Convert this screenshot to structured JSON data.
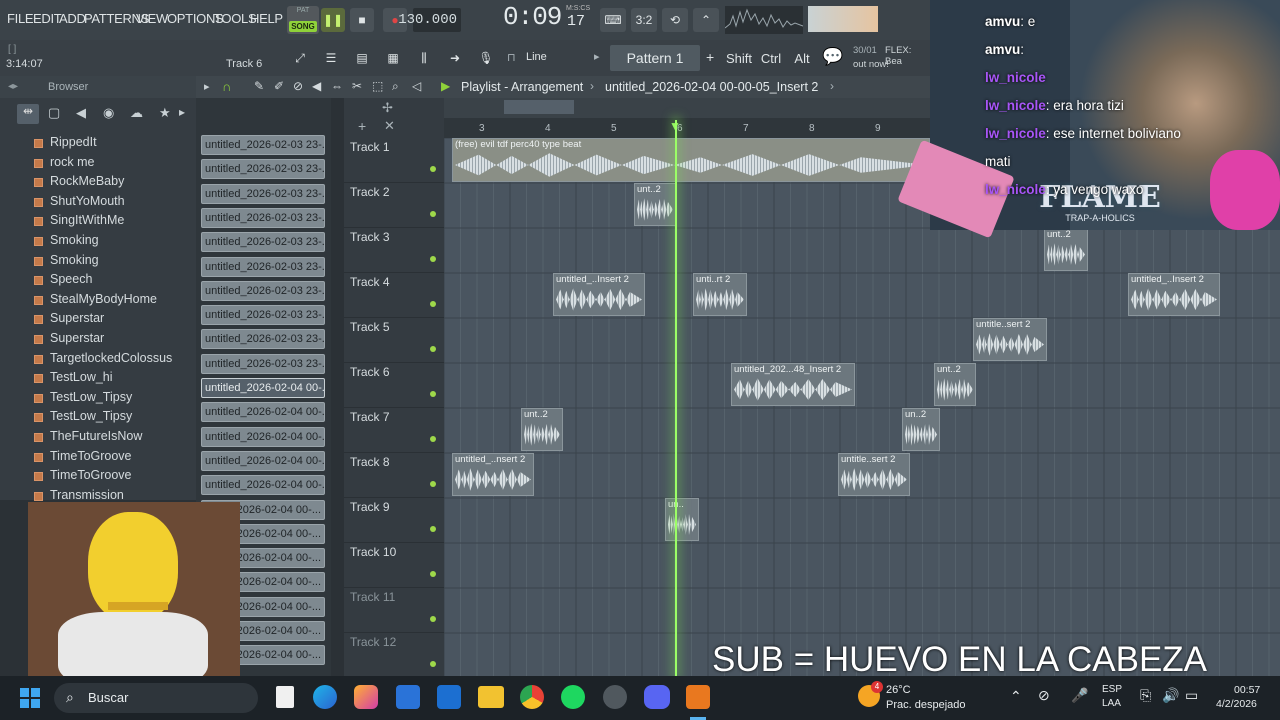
{
  "menu": {
    "items": [
      "FILE",
      "EDIT",
      "ADD",
      "PATTERNS",
      "VIEW",
      "OPTIONS",
      "TOOLS",
      "HELP"
    ]
  },
  "transport": {
    "pat_label": "PAT",
    "song_label": "SONG",
    "tempo": "130.000",
    "time": "0:09",
    "time_ms": "17",
    "time_unit": "M:S:CS",
    "time_sig": "3:2"
  },
  "toolbar2": {
    "hint": "Track 6",
    "position": "3:14:07",
    "line_mode": "Line",
    "pattern": "Pattern 1",
    "shift": "Shift",
    "ctrl": "Ctrl",
    "alt": "Alt",
    "news_date": "30/01",
    "news_text": "FLEX: Bea",
    "news_text2": "out now!"
  },
  "browser": {
    "title": "Browser",
    "items": [
      "RippedIt",
      "rock me",
      "RockMeBaby",
      "ShutYoMouth",
      "SingItWithMe",
      "Smoking",
      "Smoking",
      "Speech",
      "StealMyBodyHome",
      "Superstar",
      "Superstar",
      "TargetlockedColossus",
      "TestLow_hi",
      "TestLow_Tipsy",
      "TestLow_Tipsy",
      "TheFutureIsNow",
      "TimeToGroove",
      "TimeToGroove",
      "Transmission"
    ]
  },
  "picker": {
    "clips": [
      "untitled_2026-02-03 23-...",
      "untitled_2026-02-03 23-...",
      "untitled_2026-02-03 23-...",
      "untitled_2026-02-03 23-...",
      "untitled_2026-02-03 23-...",
      "untitled_2026-02-03 23-...",
      "untitled_2026-02-03 23-...",
      "untitled_2026-02-03 23-...",
      "untitled_2026-02-03 23-...",
      "untitled_2026-02-03 23-...",
      "untitled_2026-02-04 00-...",
      "untitled_2026-02-04 00-...",
      "untitled_2026-02-04 00-...",
      "untitled_2026-02-04 00-...",
      "untitled_2026-02-04 00-...",
      "2026-02-04 00-...",
      "2026-02-04 00-...",
      "2026-02-04 00-...",
      "2026-02-04 00-...",
      "2026-02-04 00-...",
      "2026-02-04 00-...",
      "2026-02-04 00-..."
    ]
  },
  "playlist": {
    "title": "Playlist - Arrangement",
    "file": "untitled_2026-02-04 00-00-05_Insert 2",
    "ruler": [
      "3",
      "4",
      "5",
      "6",
      "7",
      "8",
      "9"
    ],
    "tracks": [
      "Track 1",
      "Track 2",
      "Track 3",
      "Track 4",
      "Track 5",
      "Track 6",
      "Track 7",
      "Track 8",
      "Track 9",
      "Track 10",
      "Track 11",
      "Track 12"
    ],
    "clip_labels": [
      "(free) evil tdf perc40 type beat",
      "unt..2",
      "unt..2",
      "untitled_..Insert 2",
      "unti..rt 2",
      "untitled_..Insert 2",
      "untitle..sert 2",
      "untitled_202...48_Insert 2",
      "unt..2",
      "unt..2",
      "un..2",
      "untitled_..nsert 2",
      "untitle..sert 2",
      "un.."
    ]
  },
  "chat": {
    "lines": [
      {
        "user": "amvu",
        "text": ": e",
        "color": "#ffffff"
      },
      {
        "user": "amvu",
        "text": ": ",
        "color": "#ffffff"
      },
      {
        "user": "lw_nicole",
        "text": " ",
        "color": "#a855f7"
      },
      {
        "user": "lw_nicole",
        "text": ": era hora tizi",
        "color": "#a855f7"
      },
      {
        "user": "lw_nicole",
        "text": ": ese internet boliviano",
        "color": "#a855f7"
      },
      {
        "user": "",
        "text": "mati",
        "color": "#ffffff"
      },
      {
        "user": "lw_nicole",
        "text": ": ya vengo waxo",
        "color": "#a855f7"
      }
    ]
  },
  "overlay": {
    "sub_text": "SUB = HUEVO EN LA CABEZA",
    "logo_text": "FLAME",
    "logo_sub": "TRAP-A-HOLICS"
  },
  "taskbar": {
    "search": "Buscar",
    "temp": "26°C",
    "weather": "Prac. despejado",
    "lang": "ESP",
    "lang2": "LAA",
    "time": "00:57",
    "date": "4/2/2026",
    "badge": "4"
  }
}
